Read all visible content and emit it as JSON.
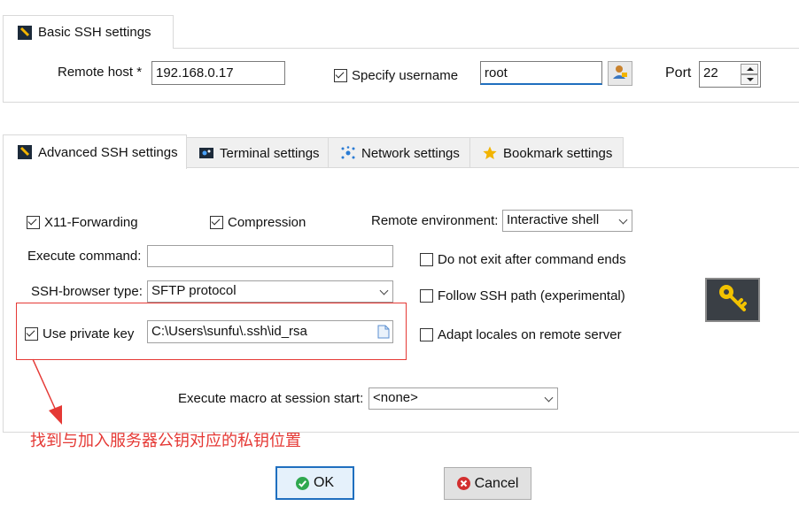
{
  "basic_tab": {
    "label": "Basic SSH settings"
  },
  "basic": {
    "remote_host_label": "Remote host *",
    "remote_host_value": "192.168.0.17",
    "specify_username_label": "Specify username",
    "specify_username_checked": true,
    "username_value": "root",
    "port_label": "Port",
    "port_value": "22"
  },
  "tabs": [
    {
      "label": "Advanced SSH settings",
      "icon": "wrench-icon",
      "active": true
    },
    {
      "label": "Terminal settings",
      "icon": "terminal-icon",
      "active": false
    },
    {
      "label": "Network settings",
      "icon": "network-icon",
      "active": false
    },
    {
      "label": "Bookmark settings",
      "icon": "star-icon",
      "active": false
    }
  ],
  "advanced": {
    "x11_label": "X11-Forwarding",
    "x11_checked": true,
    "compression_label": "Compression",
    "compression_checked": true,
    "remote_env_label": "Remote environment:",
    "remote_env_value": "Interactive shell",
    "execute_command_label": "Execute command:",
    "execute_command_value": "",
    "do_not_exit_label": "Do not exit after command ends",
    "do_not_exit_checked": false,
    "ssh_browser_label": "SSH-browser type:",
    "ssh_browser_value": "SFTP protocol",
    "follow_ssh_label": "Follow SSH path (experimental)",
    "follow_ssh_checked": false,
    "use_private_key_label": "Use private key",
    "use_private_key_checked": true,
    "private_key_path": "C:\\Users\\sunfu\\.ssh\\id_rsa",
    "adapt_locales_label": "Adapt locales on remote server",
    "adapt_locales_checked": false,
    "macro_label": "Execute macro at session start:",
    "macro_value": "<none>"
  },
  "annotation": {
    "text": "找到与加入服务器公钥对应的私钥位置",
    "color": "#e53935"
  },
  "buttons": {
    "ok_label": "OK",
    "cancel_label": "Cancel"
  },
  "colors": {
    "ok_green": "#2fa84f",
    "cancel_red": "#d32f2f",
    "key_yellow": "#f2c200",
    "focus_blue": "#1f6fbf"
  }
}
